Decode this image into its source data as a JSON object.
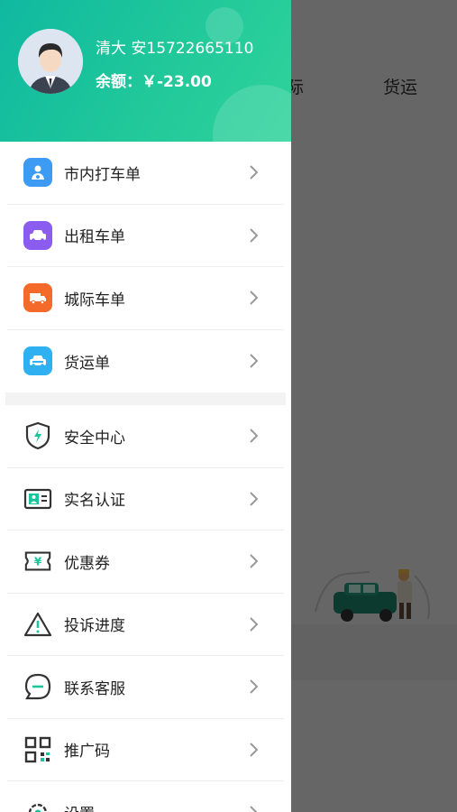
{
  "background": {
    "tabs": [
      "际",
      "货运"
    ]
  },
  "user": {
    "name": "清大 安15722665110",
    "balance": "余额：￥-23.00"
  },
  "menu_group1": [
    {
      "label": "市内打车单",
      "icon": "car-driver-icon",
      "color": "#3e9bf3"
    },
    {
      "label": "出租车单",
      "icon": "taxi-icon",
      "color": "#8a5cf0"
    },
    {
      "label": "城际车单",
      "icon": "truck-icon",
      "color": "#f36a2a"
    },
    {
      "label": "货运单",
      "icon": "car-icon",
      "color": "#2fb0f0"
    }
  ],
  "menu_group2": [
    {
      "label": "安全中心",
      "icon": "shield-icon"
    },
    {
      "label": "实名认证",
      "icon": "id-card-icon"
    },
    {
      "label": "优惠券",
      "icon": "coupon-icon"
    },
    {
      "label": "投诉进度",
      "icon": "warning-icon"
    },
    {
      "label": "联系客服",
      "icon": "chat-icon"
    },
    {
      "label": "推广码",
      "icon": "qr-code-icon"
    },
    {
      "label": "设置",
      "icon": "gear-icon"
    }
  ],
  "colors": {
    "accent_green": "#1bc49b",
    "icon_dark": "#333333"
  }
}
